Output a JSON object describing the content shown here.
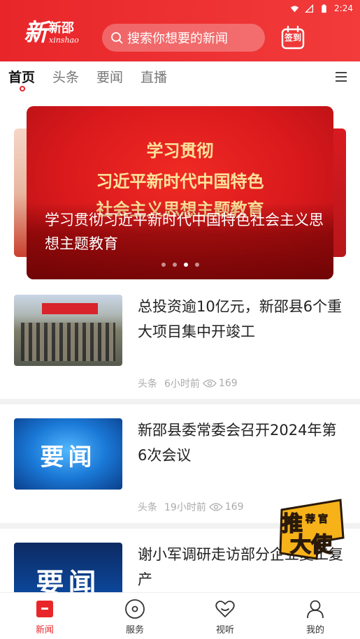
{
  "status_bar": {
    "time": "2:24"
  },
  "header": {
    "logo_big": "新",
    "logo_cn": "新邵",
    "logo_en": "xinshao",
    "search_placeholder": "搜索你想要的新闻",
    "checkin_label": "签到"
  },
  "tabs": [
    {
      "label": "首页",
      "active": true
    },
    {
      "label": "头条",
      "active": false
    },
    {
      "label": "要闻",
      "active": false
    },
    {
      "label": "直播",
      "active": false
    }
  ],
  "banner": {
    "image_text": [
      "学习贯彻",
      "习近平新时代中国特色",
      "社会主义思想主题教育"
    ],
    "caption": "学习贯彻习近平新时代中国特色社会主义思想主题教育",
    "dot_count": 4,
    "active_dot": 2
  },
  "news": [
    {
      "title": "总投资逾10亿元，新邵县6个重大项目集中开竣工",
      "category": "头条",
      "time": "6小时前",
      "views": "169"
    },
    {
      "title": "新邵县委常委会召开2024年第6次会议",
      "category": "头条",
      "time": "19小时前",
      "views": "169",
      "thumb_text": "要闻"
    },
    {
      "title": "谢小军调研走访部分企业复工复产",
      "thumb_text": "要闻"
    }
  ],
  "promo": {
    "line1": "推",
    "line2": "荐",
    "line3": "官",
    "line4": "大使"
  },
  "bottom_nav": [
    {
      "label": "新闻",
      "icon": "news-icon",
      "active": true
    },
    {
      "label": "服务",
      "icon": "service-icon",
      "active": false
    },
    {
      "label": "视听",
      "icon": "heart-icon",
      "active": false
    },
    {
      "label": "我的",
      "icon": "profile-icon",
      "active": false
    }
  ],
  "colors": {
    "brand_red": "#e8262a",
    "muted": "#aaaaaa"
  }
}
